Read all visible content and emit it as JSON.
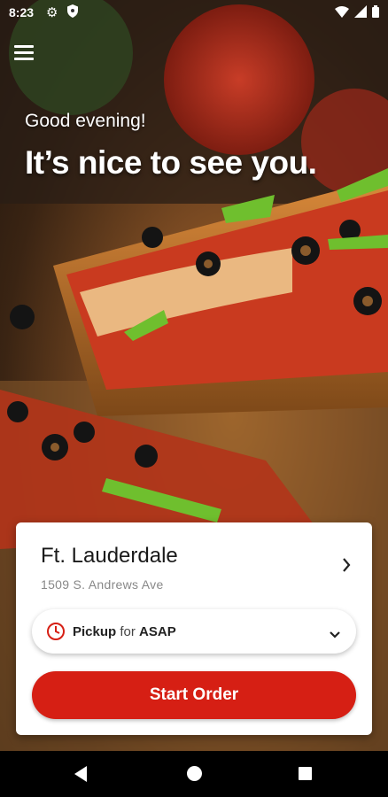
{
  "status_bar": {
    "time": "8:23",
    "icons": [
      "gear-icon",
      "shield-icon",
      "wifi-icon",
      "signal-icon",
      "battery-icon"
    ]
  },
  "header": {
    "menu_icon": "hamburger-menu-icon",
    "greeting": "Good evening!",
    "headline": "It’s nice to see you."
  },
  "background": {
    "image": "pizza-photo"
  },
  "store": {
    "name": "Ft. Lauderdale",
    "address": "1509 S. Andrews Ave"
  },
  "order_mode": {
    "mode": "Pickup",
    "connector": "for",
    "time": "ASAP"
  },
  "start_order": {
    "label": "Start Order"
  },
  "colors": {
    "accent": "#d61f14"
  }
}
